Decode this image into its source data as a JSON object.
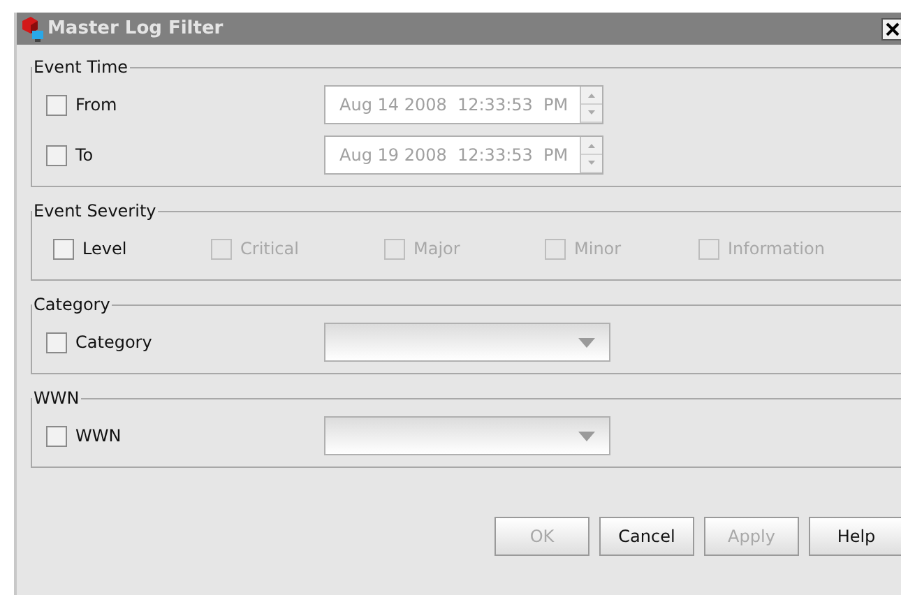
{
  "window": {
    "title": "Master Log Filter"
  },
  "event_time": {
    "legend": "Event Time",
    "rows": [
      {
        "label": "From",
        "checked": false,
        "value": "Aug 14 2008  12:33:53  PM",
        "disabled": true
      },
      {
        "label": "To",
        "checked": false,
        "value": "Aug 19 2008  12:33:53  PM",
        "disabled": true
      }
    ]
  },
  "event_severity": {
    "legend": "Event Severity",
    "options": [
      {
        "label": "Level",
        "checked": false,
        "disabled": false
      },
      {
        "label": "Critical",
        "checked": false,
        "disabled": true
      },
      {
        "label": "Major",
        "checked": false,
        "disabled": true
      },
      {
        "label": "Minor",
        "checked": false,
        "disabled": true
      },
      {
        "label": "Information",
        "checked": false,
        "disabled": true
      }
    ]
  },
  "category": {
    "legend": "Category",
    "label": "Category",
    "checked": false
  },
  "wwn": {
    "legend": "WWN",
    "label": "WWN",
    "checked": false
  },
  "buttons": [
    {
      "label": "OK",
      "disabled": true
    },
    {
      "label": "Cancel",
      "disabled": false
    },
    {
      "label": "Apply",
      "disabled": true
    },
    {
      "label": "Help",
      "disabled": false
    }
  ]
}
